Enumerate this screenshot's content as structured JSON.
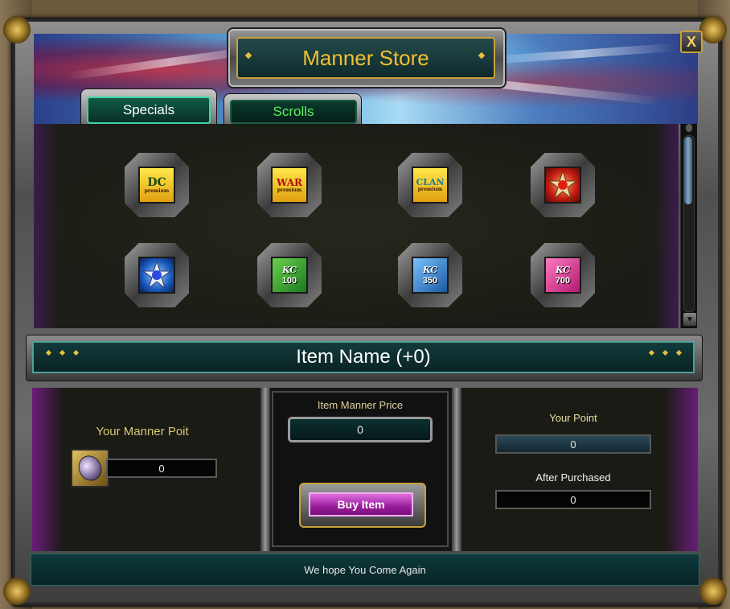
{
  "store": {
    "title": "Manner Store",
    "close_label": "X"
  },
  "tabs": [
    {
      "label": "Specials",
      "active": true
    },
    {
      "label": "Scrolls",
      "active": false
    }
  ],
  "items": [
    {
      "icon": "dc-premium-icon",
      "label": "DC",
      "sublabel": "premium"
    },
    {
      "icon": "war-premium-icon",
      "label": "WAR",
      "sublabel": "premium"
    },
    {
      "icon": "clan-premium-icon",
      "label": "CLAN",
      "sublabel": "premium"
    },
    {
      "icon": "red-star-gem-icon"
    },
    {
      "icon": "blue-star-gem-icon"
    },
    {
      "icon": "kc-scroll-100-icon",
      "label": "KC",
      "sublabel": "100"
    },
    {
      "icon": "kc-scroll-350-icon",
      "label": "KC",
      "sublabel": "350"
    },
    {
      "icon": "kc-scroll-700-icon",
      "label": "KC",
      "sublabel": "700"
    }
  ],
  "item_name": "Item Name (+0)",
  "manner": {
    "your_manner_label": "Your Manner Poit",
    "your_manner_value": "0",
    "price_label": "Item Manner Price",
    "price_value": "0",
    "buy_label": "Buy Item",
    "your_point_label": "Your Point",
    "your_point_value": "0",
    "after_label": "After Purchased",
    "after_value": "0"
  },
  "footer": "We hope You Come Again",
  "colors": {
    "gold": "#f0c030",
    "teal": "#0f2a2c",
    "buy_magenta": "#9a1c9c"
  }
}
